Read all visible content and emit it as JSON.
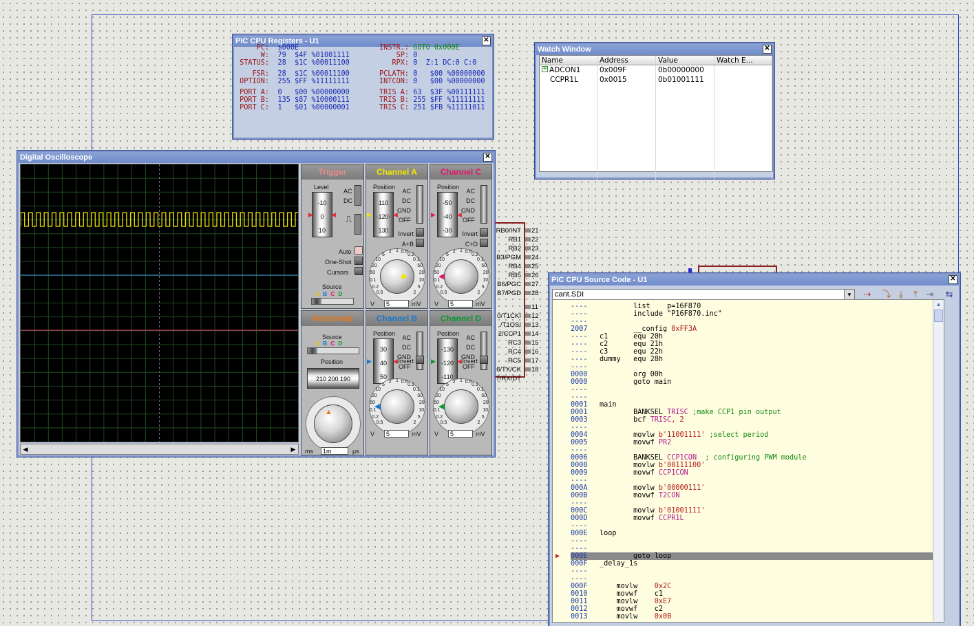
{
  "registers": {
    "title": "PIC CPU Registers - U1",
    "lines": [
      {
        "l": "     PC:",
        "v": " $000E        ",
        "l2": "  INSTR.:",
        "v2": " GOTO 0x000E"
      },
      {
        "l": "      W:",
        "v": " 79  $4F %01001111",
        "l2": "      SP:",
        "v2": " 0"
      },
      {
        "l": " STATUS:",
        "v": " 28  $1C %00011100",
        "l2": "     RPX:",
        "v2": " 0  Z:1 DC:0 C:0"
      },
      {
        "l": "",
        "v": "",
        "l2": "",
        "v2": ""
      },
      {
        "l": "    FSR:",
        "v": " 28  $1C %00011100",
        "l2": "  PCLATH:",
        "v2": " 0   $00 %00000000"
      },
      {
        "l": " OPTION:",
        "v": " 255 $FF %11111111",
        "l2": "  INTCON:",
        "v2": " 0   $00 %00000000"
      },
      {
        "l": "",
        "v": "",
        "l2": "",
        "v2": ""
      },
      {
        "l": " PORT A:",
        "v": " 0   $00 %00000000",
        "l2": "  TRIS A:",
        "v2": " 63  $3F %00111111"
      },
      {
        "l": " PORT B:",
        "v": " 135 $87 %10000111",
        "l2": "  TRIS B:",
        "v2": " 255 $FF %11111111"
      },
      {
        "l": " PORT C:",
        "v": " 1   $01 %00000001",
        "l2": "  TRIS C:",
        "v2": " 251 $FB %11111011"
      }
    ]
  },
  "watch": {
    "title": "Watch Window",
    "headers": [
      "Name",
      "Address",
      "Value",
      "Watch E..."
    ],
    "rows": [
      {
        "name": "ADCON1",
        "address": "0x009F",
        "value": "0b00000000",
        "expand": "+"
      },
      {
        "name": "CCPR1L",
        "address": "0x0015",
        "value": "0b01001111",
        "expand": ""
      }
    ]
  },
  "scope": {
    "title": "Digital Oscilloscope",
    "trigger": {
      "title": "Trigger",
      "level": "Level",
      "ac": "AC",
      "dc": "DC",
      "auto": "Auto",
      "oneshot": "One-Shot",
      "cursors": "Cursors",
      "source": "Source",
      "drum": [
        "-10",
        "0",
        "10"
      ]
    },
    "sources": [
      "A",
      "B",
      "C",
      "D"
    ],
    "channels": [
      {
        "key": "a",
        "title": "Channel A",
        "color": "#f2e600",
        "drum": [
          "110",
          "-120-",
          "130"
        ],
        "opt": [
          "AC",
          "DC",
          "GND",
          "OFF"
        ],
        "invert": "Invert",
        "combo": "A+B",
        "field": "5"
      },
      {
        "key": "c",
        "title": "Channel C",
        "color": "#e0186a",
        "drum": [
          "-50",
          "-40",
          "-30"
        ],
        "opt": [
          "AC",
          "DC",
          "GND",
          "OFF"
        ],
        "invert": "Invert",
        "combo": "C+D",
        "field": "5"
      },
      {
        "key": "b",
        "title": "Channel B",
        "color": "#1a78d0",
        "drum": [
          "30",
          "40",
          "50"
        ],
        "opt": [
          "AC",
          "DC",
          "GND",
          "OFF"
        ],
        "invert": "Invert",
        "combo": "",
        "field": "5"
      },
      {
        "key": "d",
        "title": "Channel D",
        "color": "#0a9a30",
        "drum": [
          "-130",
          "-120",
          "-110"
        ],
        "opt": [
          "AC",
          "DC",
          "GND",
          "OFF"
        ],
        "invert": "Invert",
        "combo": "",
        "field": "5"
      }
    ],
    "horizontal": {
      "title": "Horizontal",
      "source": "Source",
      "position": "Position",
      "pos_vals": "210 200 190",
      "field": "1m",
      "unit_l": "ms",
      "unit_r": "µs"
    },
    "position_label": "Position",
    "volt_scale": [
      "0.5",
      "0.2",
      "0.1",
      "50",
      "20",
      "10",
      "5",
      "2",
      "1",
      "0.5",
      "0.2",
      "0.1",
      "50",
      "20",
      "10",
      "5",
      "2"
    ],
    "unit_v": "V",
    "unit_mv": "mV"
  },
  "pins": {
    "labels": [
      "RB0/INT",
      "RB1",
      "RB2",
      "B3/PGM",
      "RB4",
      "RB5",
      "B6/PGC",
      "B7/PGD",
      "",
      "0/T1CKI",
      "/T1OSI",
      "2/CCP1",
      "RC3",
      "RC4",
      "RC5",
      "6/TX/CK",
      "7/RX/DT"
    ],
    "numbers": [
      "21",
      "22",
      "23",
      "24",
      "25",
      "26",
      "27",
      "28",
      "11",
      "12",
      "13",
      "14",
      "15",
      "16",
      "17",
      "18"
    ]
  },
  "source": {
    "title": "PIC CPU Source Code - U1",
    "file": "cant.SDI",
    "lines": [
      {
        "a": "----",
        "t": "        list    p=16F870"
      },
      {
        "a": "----",
        "t": "        include \"P16F870.inc\""
      },
      {
        "a": "----",
        "t": ""
      },
      {
        "a": "2007",
        "t": "        __config ",
        "n": "0xFF3A"
      },
      {
        "a": "----",
        "t": "c1      equ 20h"
      },
      {
        "a": "----",
        "t": "c2      equ 21h"
      },
      {
        "a": "----",
        "t": "c3      equ 22h"
      },
      {
        "a": "----",
        "t": "dummy   equ 28h"
      },
      {
        "a": "----",
        "t": ""
      },
      {
        "a": "0000",
        "t": "        org 00h"
      },
      {
        "a": "0000",
        "t": "        goto main"
      },
      {
        "a": "----",
        "t": ""
      },
      {
        "a": "----",
        "t": ""
      },
      {
        "a": "0001",
        "t": "main"
      },
      {
        "a": "0001",
        "t": "        BANKSEL ",
        "k": "TRISC",
        "c": " ;make CCP1 pin output"
      },
      {
        "a": "0003",
        "t": "        bcf ",
        "k": "TRISC",
        "n": ", 2"
      },
      {
        "a": "----",
        "t": ""
      },
      {
        "a": "0004",
        "t": "        movlw ",
        "n": "b'11001111'",
        "c": " ;select period"
      },
      {
        "a": "0005",
        "t": "        movwf ",
        "k": "PR2"
      },
      {
        "a": "----",
        "t": ""
      },
      {
        "a": "0006",
        "t": "        BANKSEL ",
        "k": "CCP1CON",
        "c": "  ; configuring PWM module"
      },
      {
        "a": "0008",
        "t": "        movlw ",
        "n": "b'00111100'"
      },
      {
        "a": "0009",
        "t": "        movwf ",
        "k": "CCP1CON"
      },
      {
        "a": "----",
        "t": ""
      },
      {
        "a": "000A",
        "t": "        movlw ",
        "n": "b'00000111'"
      },
      {
        "a": "000B",
        "t": "        movwf ",
        "k": "T2CON"
      },
      {
        "a": "----",
        "t": ""
      },
      {
        "a": "000C",
        "t": "        movlw ",
        "n": "b'01001111'"
      },
      {
        "a": "000D",
        "t": "        movwf ",
        "k": "CCPR1L"
      },
      {
        "a": "----",
        "t": ""
      },
      {
        "a": "000E",
        "t": "loop"
      },
      {
        "a": "----",
        "t": ""
      },
      {
        "a": "----",
        "t": ""
      },
      {
        "a": "000E",
        "t": "        goto loop",
        "hl": true
      },
      {
        "a": "000F",
        "t": "_delay_1s"
      },
      {
        "a": "----",
        "t": ""
      },
      {
        "a": "----",
        "t": ""
      },
      {
        "a": "000F",
        "t": "    movlw    ",
        "n": "0x2C"
      },
      {
        "a": "0010",
        "t": "    movwf    c1"
      },
      {
        "a": "0011",
        "t": "    movlw    ",
        "n": "0xE7"
      },
      {
        "a": "0012",
        "t": "    movwf    c2"
      },
      {
        "a": "0013",
        "t": "    movlw    ",
        "n": "0x0B"
      }
    ]
  }
}
